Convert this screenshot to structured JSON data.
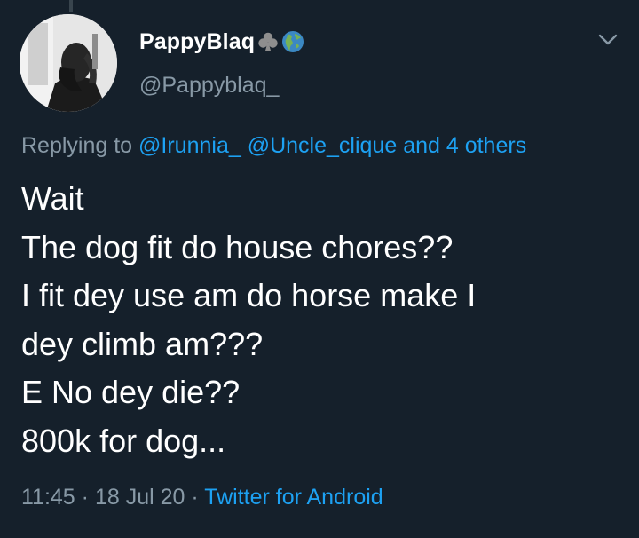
{
  "author": {
    "display_name": "PappyBlaq",
    "handle": "@Pappyblaq_",
    "badges": [
      "club-suit-icon",
      "globe-americas-icon"
    ]
  },
  "reply": {
    "prefix": "Replying to",
    "mention_1": "@Irunnia_",
    "mention_2": "@Uncle_clique",
    "suffix": "and 4 others"
  },
  "tweet": {
    "lines": [
      "Wait",
      "The dog fit do house chores??",
      "I fit dey use am do horse make I",
      "dey climb am???",
      "E No dey die??",
      "800k for dog..."
    ]
  },
  "meta": {
    "time": "11:45",
    "date": "18 Jul 20",
    "separator": "·",
    "source": "Twitter for Android"
  },
  "colors": {
    "background": "#15202b",
    "text": "#ffffff",
    "secondary": "#8899a6",
    "link": "#1da1f2"
  }
}
